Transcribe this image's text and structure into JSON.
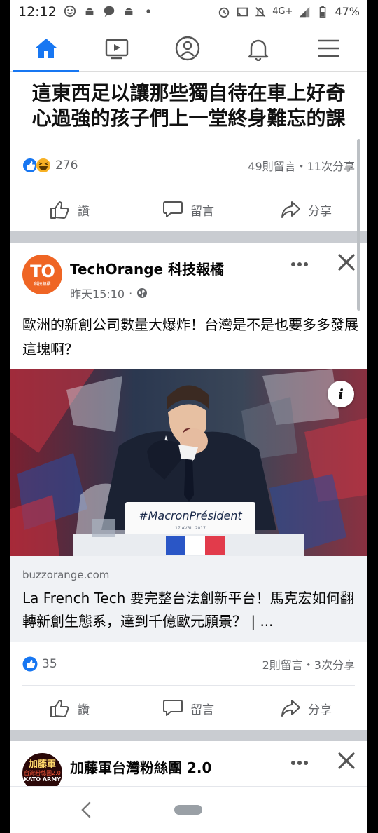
{
  "status_bar": {
    "time": "12:12",
    "network": "4G+",
    "battery": "47%"
  },
  "nav": {
    "items": [
      {
        "name": "home",
        "icon": "home-icon"
      },
      {
        "name": "watch",
        "icon": "video-icon"
      },
      {
        "name": "profile",
        "icon": "profile-icon"
      },
      {
        "name": "notifications",
        "icon": "bell-icon"
      },
      {
        "name": "menu",
        "icon": "menu-icon"
      }
    ],
    "active_color": "#1877f2"
  },
  "post1": {
    "headline_line1": "這東西足以讓那些獨自待在車上好奇",
    "headline_line2": "心過強的孩子們上一堂終身難忘的課",
    "reaction_count": "276",
    "comments_shares": "49則留言・11次分享",
    "actions": {
      "like": "讚",
      "comment": "留言",
      "share": "分享"
    }
  },
  "post2": {
    "avatar_text": "TO",
    "avatar_subtext": "科技報橘",
    "page_name": "TechOrange 科技報橘",
    "time": "昨天15:10",
    "time_sep": "·",
    "text": "歐洲的新創公司數量大爆炸！台灣是不是也要多多發展這塊啊？",
    "photo": {
      "podium_text": "#MacronPrésident",
      "podium_date": "17 AVRIL 2017",
      "info_label": "i"
    },
    "link": {
      "domain": "buzzorange.com",
      "title": "La French Tech 要完整台法創新平台！馬克宏如何翻轉新創生態系，達到千億歐元願景？ | ..."
    },
    "reaction_count": "35",
    "comments_shares": "2則留言・3次分享",
    "actions": {
      "like": "讚",
      "comment": "留言",
      "share": "分享"
    }
  },
  "post3": {
    "avatar_line1": "加藤軍",
    "avatar_line2": "台灣粉絲團2.0",
    "avatar_line3": "KATO ARMY",
    "page_name": "加藤軍台灣粉絲團 2.0"
  },
  "colors": {
    "brand_blue": "#1877f2",
    "techorange": "#ef6524",
    "muted_text": "#65676b",
    "feed_gap": "#c9ccd1"
  }
}
